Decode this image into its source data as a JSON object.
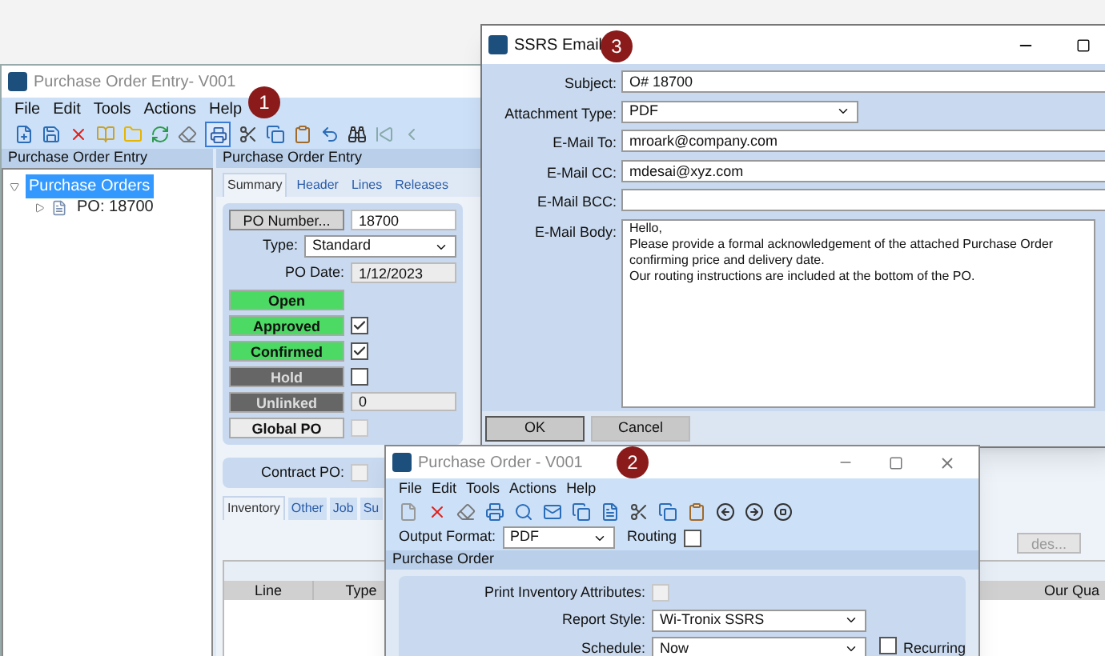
{
  "po_entry_window": {
    "title": "Purchase Order Entry- V001",
    "menu": [
      "File",
      "Edit",
      "Tools",
      "Actions",
      "Help"
    ],
    "tree_panel": {
      "title": "Purchase Order Entry",
      "items": [
        {
          "label": "Purchase Orders",
          "selected": true,
          "expanded": true,
          "children": [
            {
              "label": "PO: 18700",
              "selected": false,
              "expanded": false
            }
          ]
        }
      ]
    },
    "form_panel": {
      "title": "Purchase Order Entry",
      "tabs": [
        {
          "label": "Summary",
          "selected": true
        },
        {
          "label": "Header",
          "selected": false
        },
        {
          "label": "Lines",
          "selected": false
        },
        {
          "label": "Releases",
          "selected": false
        }
      ],
      "po_number_button": "PO Number...",
      "po_number": "18700",
      "type_label": "Type:",
      "type_value": "Standard",
      "po_date_label": "PO Date:",
      "po_date": "1/12/2023",
      "status_flags": [
        {
          "label": "Open",
          "kind": "none",
          "color": "#4cd964"
        },
        {
          "label": "Approved",
          "kind": "checkbox",
          "color": "#4cd964",
          "checked": true
        },
        {
          "label": "Confirmed",
          "kind": "checkbox",
          "color": "#4cd964",
          "checked": true
        },
        {
          "label": "Hold",
          "kind": "checkbox",
          "color": "#666666",
          "checked": false
        },
        {
          "label": "Unlinked",
          "kind": "field",
          "color": "#666666",
          "value": "0"
        },
        {
          "label": "Global PO",
          "kind": "checkbox",
          "color": "#ececec",
          "checked": false,
          "disabled": true
        }
      ],
      "contract_po_label": "Contract PO:",
      "contract_po_checked": false,
      "lower_tabs": [
        {
          "label": "Inventory",
          "selected": true
        },
        {
          "label": "Other",
          "selected": false
        },
        {
          "label": "Job",
          "selected": false
        },
        {
          "label": "Su",
          "selected": false
        }
      ],
      "side_button": "des...",
      "table": {
        "columns": [
          "Line",
          "Type",
          "Our Qua"
        ]
      }
    }
  },
  "email_window": {
    "title": "SSRS Email",
    "fields": [
      {
        "label": "Subject:",
        "kind": "text",
        "value": "O# 18700"
      },
      {
        "label": "Attachment Type:",
        "kind": "dropdown",
        "value": "PDF"
      },
      {
        "label": "E-Mail To:",
        "kind": "text",
        "value": "mroark@company.com"
      },
      {
        "label": "E-Mail CC:",
        "kind": "text",
        "value": "mdesai@xyz.com"
      },
      {
        "label": "E-Mail BCC:",
        "kind": "text"
      },
      {
        "label": "E-Mail Body:",
        "kind": "multiline",
        "value": "Hello,\nPlease provide a formal acknowledgement of the attached Purchase Order confirming price and delivery date.\nOur routing instructions are included at the bottom of the PO."
      }
    ],
    "buttons": [
      "OK",
      "Cancel"
    ]
  },
  "po_window": {
    "title": "Purchase Order - V001",
    "menu": [
      "File",
      "Edit",
      "Tools",
      "Actions",
      "Help"
    ],
    "output_format_label": "Output Format:",
    "output_format": "PDF",
    "routing_label": "Routing",
    "routing_checked": false,
    "panel_title": "Purchase Order",
    "print_inventory_label": "Print Inventory Attributes:",
    "print_inventory_checked": false,
    "report_style_label": "Report Style:",
    "report_style": "Wi-Tronix SSRS",
    "schedule_label": "Schedule:",
    "schedule": "Now",
    "recurring_label": "Recurring",
    "recurring_checked": false
  },
  "callouts": [
    "1",
    "2",
    "3"
  ]
}
